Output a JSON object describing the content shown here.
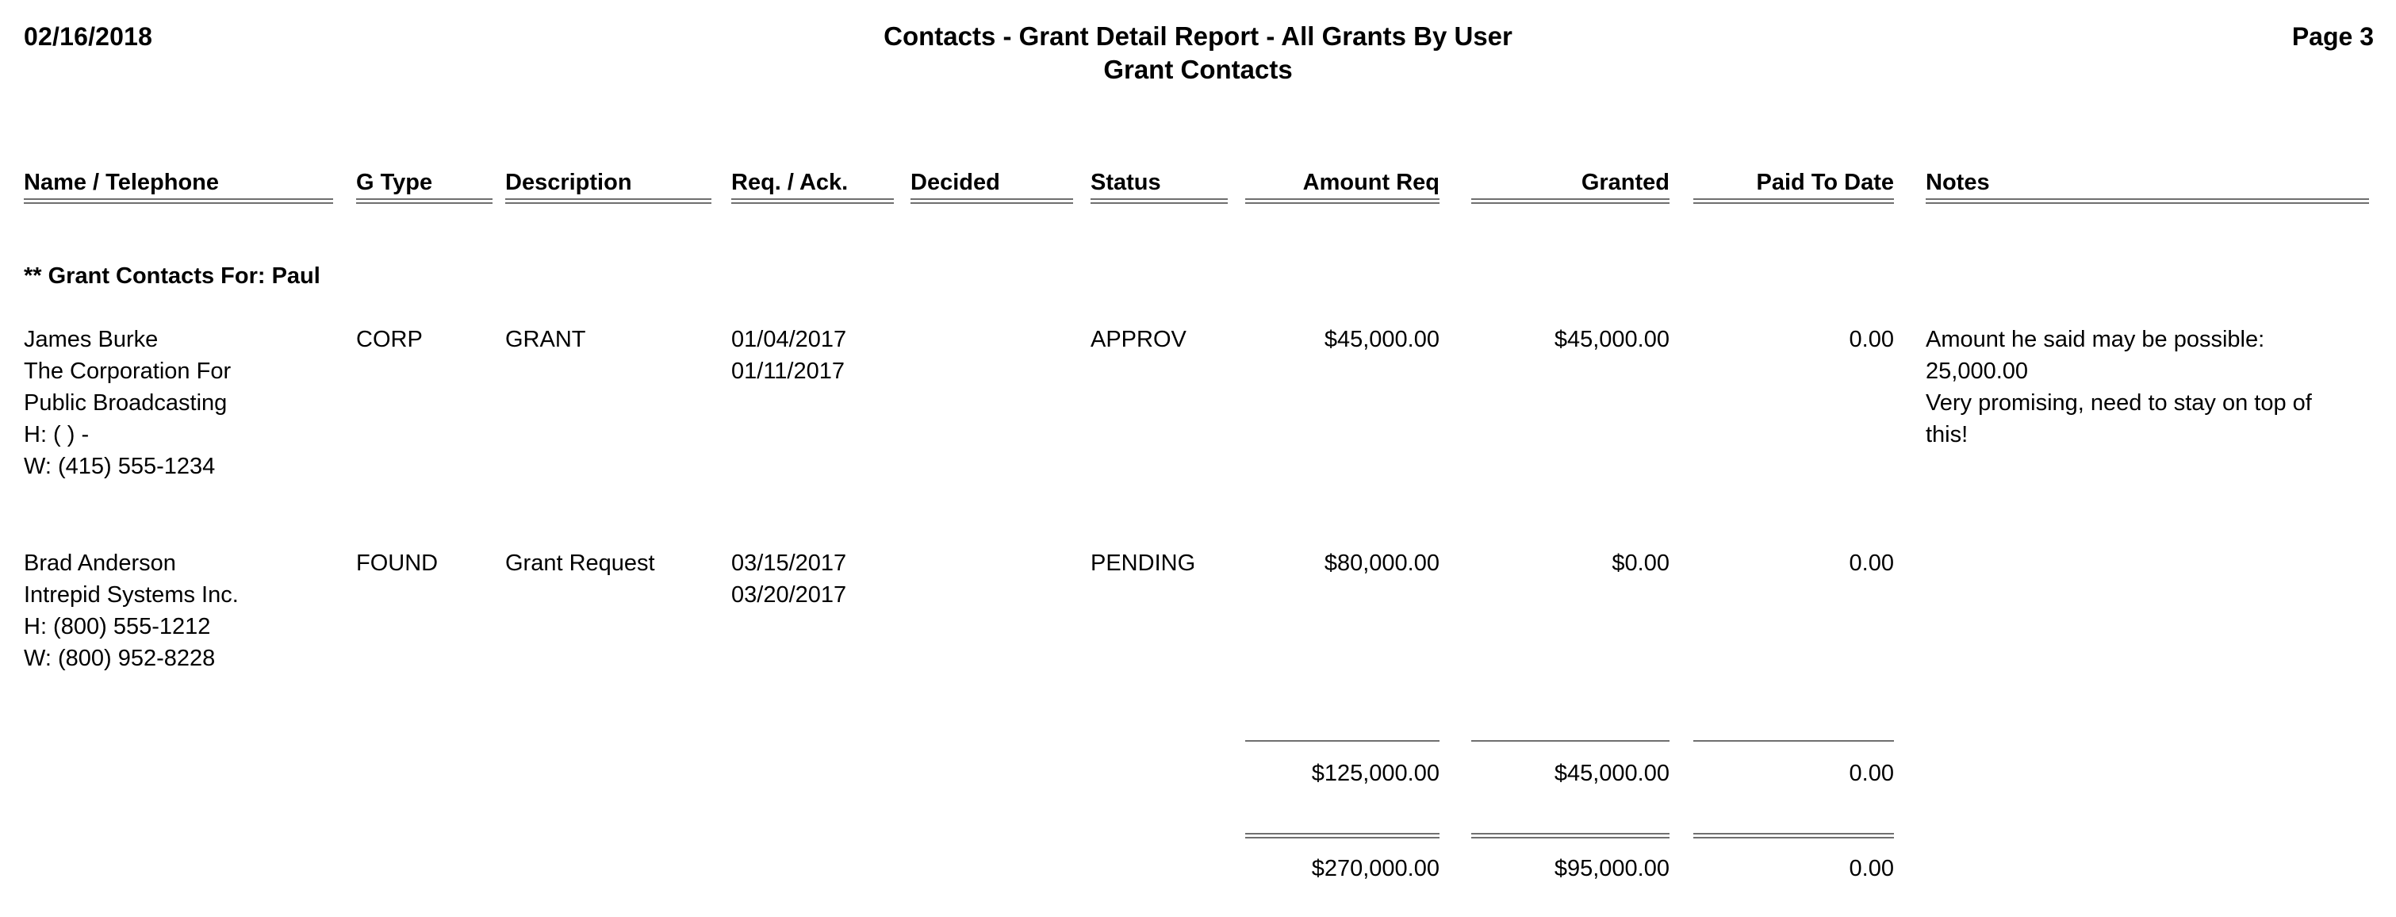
{
  "header": {
    "date": "02/16/2018",
    "title_line1": "Contacts - Grant Detail Report - All Grants By User",
    "title_line2": "Grant Contacts",
    "page_label": "Page 3"
  },
  "columns": {
    "name_telephone": "Name / Telephone",
    "g_type": "G Type",
    "description": "Description",
    "req_ack": "Req. / Ack.",
    "decided": "Decided",
    "status": "Status",
    "amount_req": "Amount Req",
    "granted": "Granted",
    "paid_to_date": "Paid To Date",
    "notes": "Notes"
  },
  "group": {
    "label": "** Grant Contacts For: Paul"
  },
  "rows": [
    {
      "name": "James Burke",
      "company_line1": "The Corporation For",
      "company_line2": "Public Broadcasting",
      "home_phone": "H: (  )     -",
      "work_phone": "W: (415) 555-1234",
      "g_type": "CORP",
      "description": "GRANT",
      "requested": "01/04/2017",
      "acknowledged": "01/11/2017",
      "decided": "",
      "status": "APPROV",
      "amount_req": "$45,000.00",
      "granted": "$45,000.00",
      "paid_to_date": "0.00",
      "notes_line1": "Amount he said may be possible:",
      "notes_line2": "25,000.00",
      "notes_line3": "Very promising, need to stay on top of",
      "notes_line4": "this!"
    },
    {
      "name": "Brad Anderson",
      "company_line1": "Intrepid Systems Inc.",
      "company_line2": "",
      "home_phone": "H: (800) 555-1212",
      "work_phone": "W: (800) 952-8228",
      "g_type": "FOUND",
      "description": "Grant Request",
      "requested": "03/15/2017",
      "acknowledged": "03/20/2017",
      "decided": "",
      "status": "PENDING",
      "amount_req": "$80,000.00",
      "granted": "$0.00",
      "paid_to_date": "0.00",
      "notes_line1": "",
      "notes_line2": "",
      "notes_line3": "",
      "notes_line4": ""
    }
  ],
  "subtotal": {
    "amount_req": "$125,000.00",
    "granted": "$45,000.00",
    "paid_to_date": "0.00"
  },
  "grandtotal": {
    "amount_req": "$270,000.00",
    "granted": "$95,000.00",
    "paid_to_date": "0.00"
  },
  "colors": {
    "text": "#000000",
    "rule": "#6f6f6f",
    "background": "#ffffff"
  }
}
